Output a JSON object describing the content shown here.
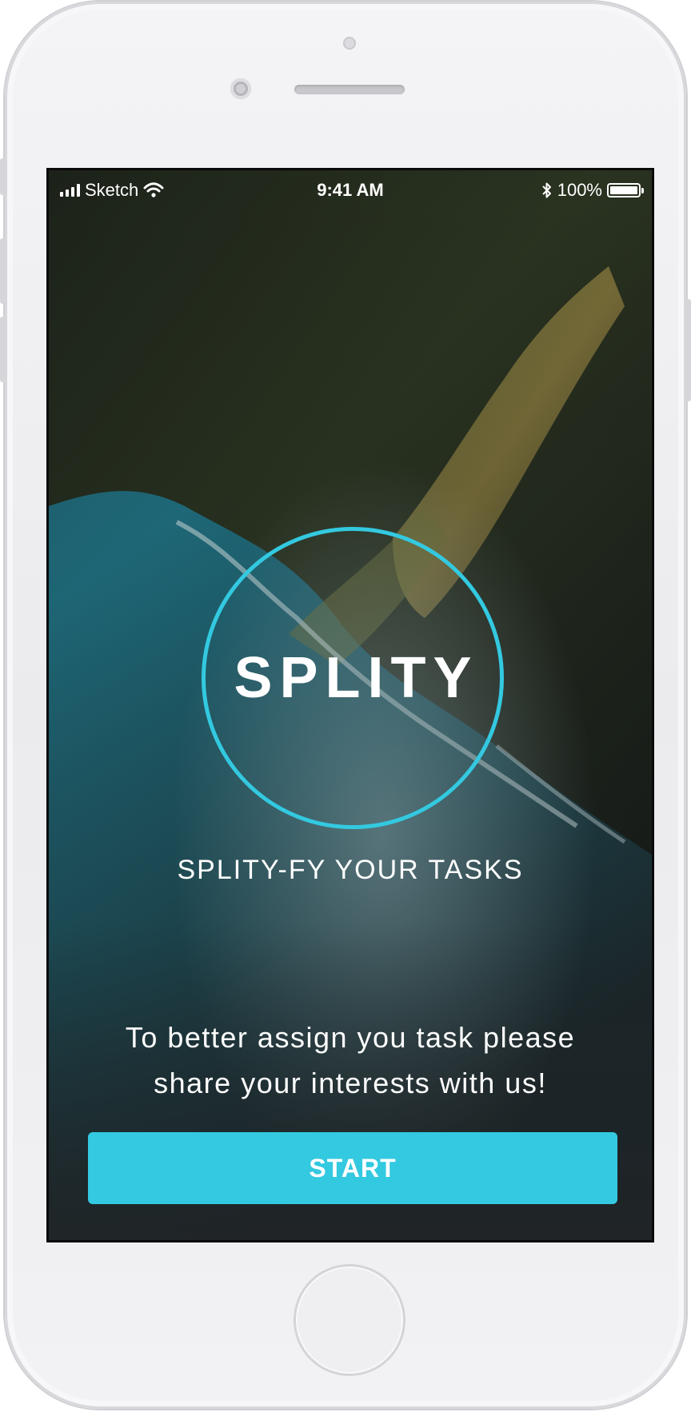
{
  "status_bar": {
    "carrier": "Sketch",
    "time": "9:41 AM",
    "battery_percent": "100%",
    "battery_level": 1.0,
    "icons": [
      "signal-icon",
      "wifi-icon",
      "bluetooth-icon",
      "battery-icon"
    ]
  },
  "logo": {
    "text": "SPLITY",
    "ring_color": "#33c9e0"
  },
  "tagline": "SPLITY-FY YOUR TASKS",
  "prompt": {
    "line1": "To better assign you task please",
    "line2": "share your interests with us!"
  },
  "start_button": {
    "label": "START",
    "color": "#33c9e0"
  }
}
